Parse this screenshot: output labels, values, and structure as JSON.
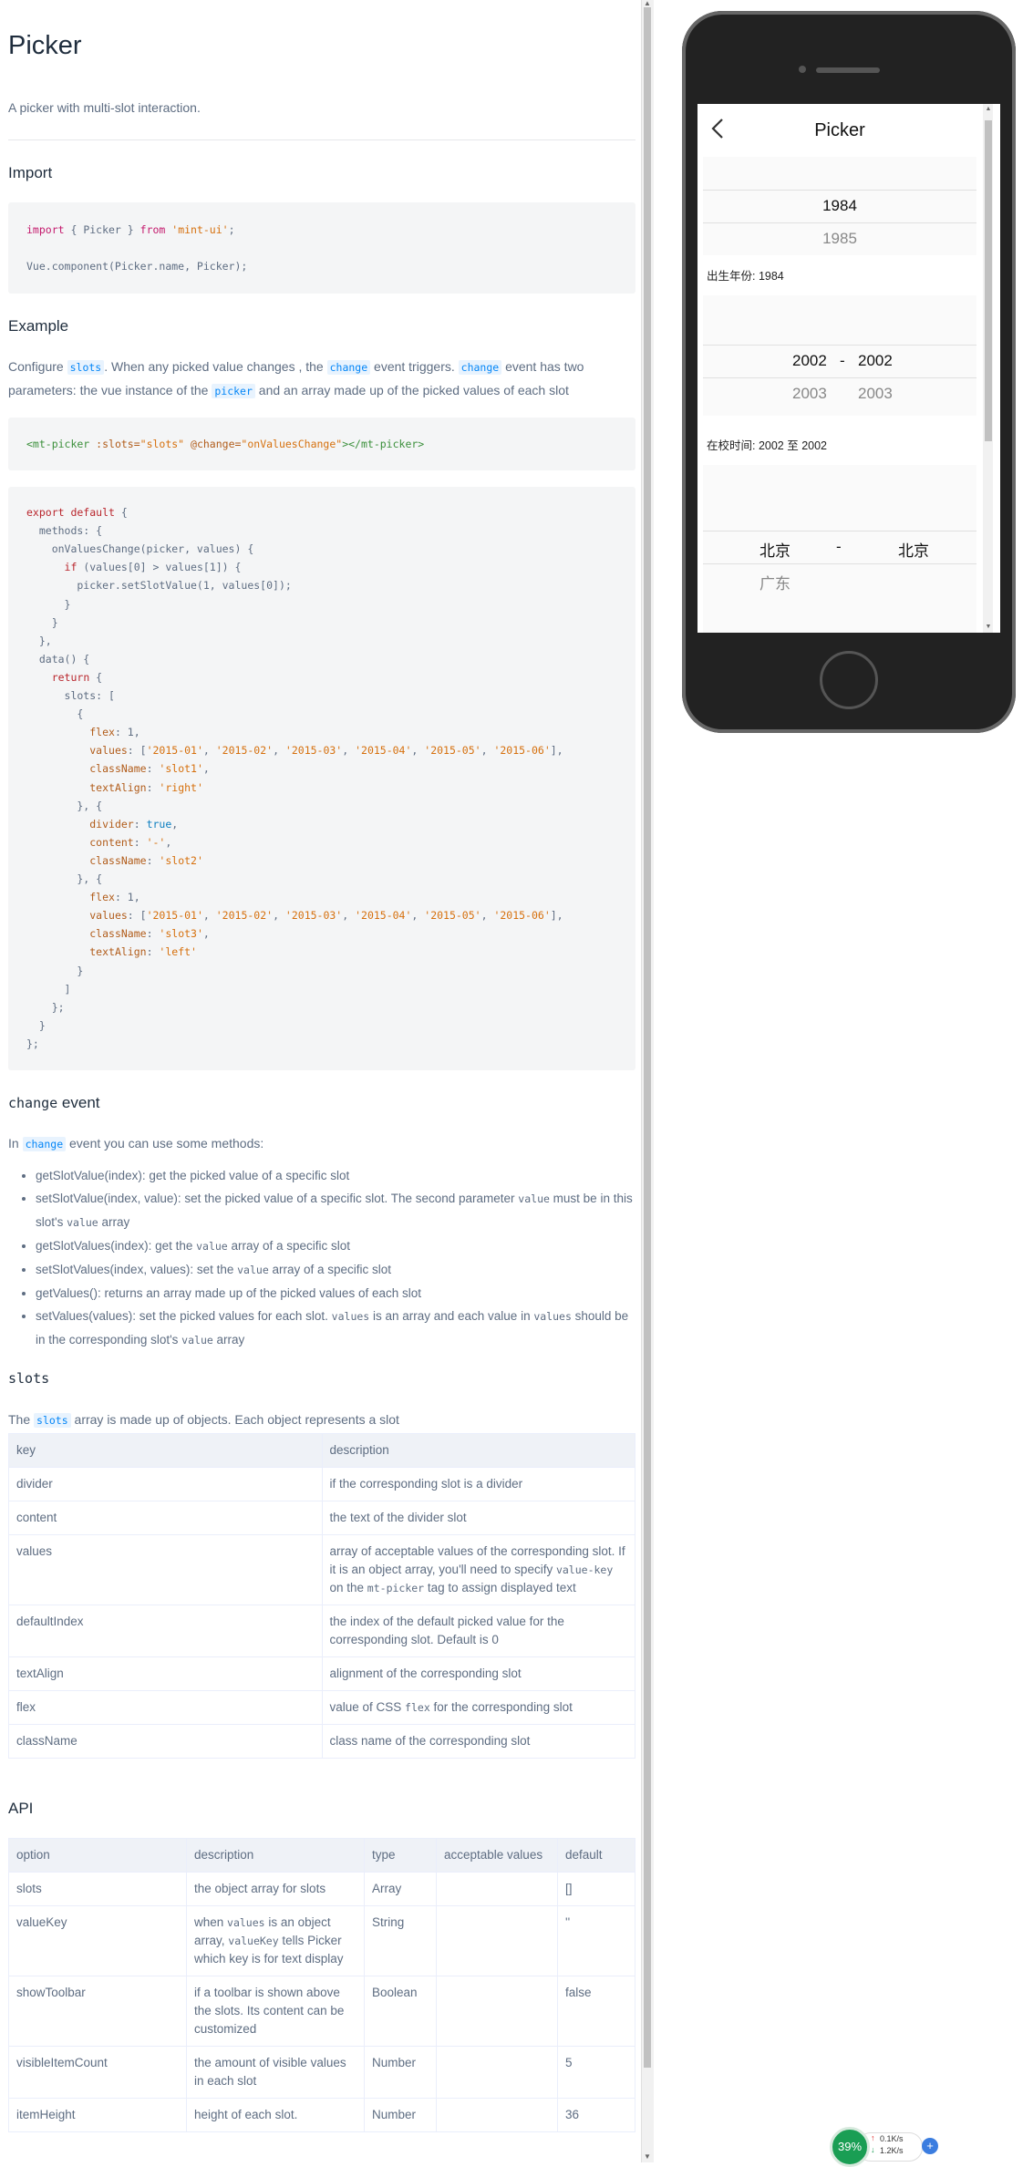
{
  "title": "Picker",
  "intro": "A picker with multi-slot interaction.",
  "sections": {
    "import": "Import",
    "example": "Example",
    "change_event_code": "change",
    "change_event_word": " event",
    "slots": "slots",
    "api": "API"
  },
  "import_code": {
    "l1_kw": "import",
    "l1_mid": " { Picker } ",
    "l1_kw2": "from",
    "l1_str": " 'mint-ui'",
    "l1_end": ";",
    "l2": "Vue.component(Picker.name, Picker);"
  },
  "example_text": {
    "p1_a": "Configure ",
    "p1_code1": "slots",
    "p1_b": ". When any picked value changes , the ",
    "p1_code2": "change",
    "p1_c": " event triggers. ",
    "p1_code3": "change",
    "p1_d": " event has two",
    "p2_a": "parameters: the vue instance of the ",
    "p2_code": "picker",
    "p2_b": " and an array made up of the picked values of each slot"
  },
  "template_code": {
    "open_tag": "<mt-picker",
    "attr1": " :slots=",
    "val1": "\"slots\"",
    "attr2": " @change=",
    "val2": "\"onValuesChange\"",
    "close_tag": "></mt-picker>"
  },
  "script_code": [
    "export default {",
    "  methods: {",
    "    onValuesChange(picker, values) {",
    "      if (values[0] > values[1]) {",
    "        picker.setSlotValue(1, values[0]);",
    "      }",
    "    }",
    "  },",
    "  data() {",
    "    return {",
    "      slots: [",
    "        {",
    "          flex: 1,",
    "          values: ['2015-01', '2015-02', '2015-03', '2015-04', '2015-05', '2015-06'],",
    "          className: 'slot1',",
    "          textAlign: 'right'",
    "        }, {",
    "          divider: true,",
    "          content: '-',",
    "          className: 'slot2'",
    "        }, {",
    "          flex: 1,",
    "          values: ['2015-01', '2015-02', '2015-03', '2015-04', '2015-05', '2015-06'],",
    "          className: 'slot3',",
    "          textAlign: 'left'",
    "        }",
    "      ]",
    "    };",
    "  }",
    "};"
  ],
  "change_text": {
    "a": "In ",
    "code": "change",
    "b": " event you can use some methods:"
  },
  "methods": {
    "m1": "getSlotValue(index): get the picked value of a specific slot",
    "m2_a": "setSlotValue(index, value): set the picked value of a specific slot. The second parameter ",
    "m2_code1": "value",
    "m2_b": " must be in this slot's ",
    "m2_code2": "value",
    "m2_c": " array",
    "m3_a": "getSlotValues(index): get the ",
    "m3_code": "value",
    "m3_b": " array of a specific slot",
    "m4_a": "setSlotValues(index, values): set the ",
    "m4_code": "value",
    "m4_b": " array of a specific slot",
    "m5": "getValues(): returns an array made up of the picked values of each slot",
    "m6_a": "setValues(values): set the picked values for each slot. ",
    "m6_code1": "values",
    "m6_b": " is an array and each value in ",
    "m6_code2": "values",
    "m6_c": " should be in the corresponding slot's ",
    "m6_code3": "value",
    "m6_d": " array"
  },
  "slots_text": {
    "a": "The ",
    "code": "slots",
    "b": " array is made up of objects. Each object represents a slot"
  },
  "slots_table": {
    "headers": [
      "key",
      "description"
    ],
    "r0": [
      "divider",
      "if the corresponding slot is a divider"
    ],
    "r1": [
      "content",
      "the text of the divider slot"
    ],
    "r2_key": "values",
    "r2_a": "array of acceptable values of the corresponding slot. If it is an object array, you'll need to specify ",
    "r2_code1": "value-key",
    "r2_b": " on the ",
    "r2_code2": "mt-picker",
    "r2_c": " tag to assign displayed text",
    "r3": [
      "defaultIndex",
      "the index of the default picked value for the corresponding slot. Default is 0"
    ],
    "r4": [
      "textAlign",
      "alignment of the corresponding slot"
    ],
    "r5_key": "flex",
    "r5_a": "value of CSS ",
    "r5_code": "flex",
    "r5_b": " for the corresponding slot",
    "r6": [
      "className",
      "class name of the corresponding slot"
    ]
  },
  "api_table": {
    "headers": [
      "option",
      "description",
      "type",
      "acceptable values",
      "default"
    ],
    "r0": [
      "slots",
      "the object array for slots",
      "Array",
      "",
      "[]"
    ],
    "r1_opt": "valueKey",
    "r1_a": "when ",
    "r1_code1": "values",
    "r1_b": " is an object array, ",
    "r1_code2": "valueKey",
    "r1_c": " tells Picker which key is for text display",
    "r1_type": "String",
    "r1_acc": "",
    "r1_def": "''",
    "r2": [
      "showToolbar",
      "if a toolbar is shown above the slots. Its content can be customized",
      "Boolean",
      "",
      "false"
    ],
    "r3": [
      "visibleItemCount",
      "the amount of visible values in each slot",
      "Number",
      "",
      "5"
    ],
    "r4": [
      "itemHeight",
      "height of each slot.",
      "Number",
      "",
      "36"
    ]
  },
  "phone": {
    "nav_title": "Picker",
    "picker1": {
      "selected": "1984",
      "next": "1985",
      "output": "出生年份: 1984"
    },
    "picker2": {
      "sel_left": "2002",
      "sel_div": "-",
      "sel_right": "2002",
      "next_left": "2003",
      "next_right": "2003",
      "output": "在校时间: 2002 至 2002"
    },
    "picker3": {
      "sel_left": "北京",
      "sel_div": "-",
      "sel_right": "北京",
      "next_left": "广东"
    }
  },
  "net_widget": {
    "percent": "39%",
    "up": "0.1K/s",
    "down": "1.2K/s"
  }
}
